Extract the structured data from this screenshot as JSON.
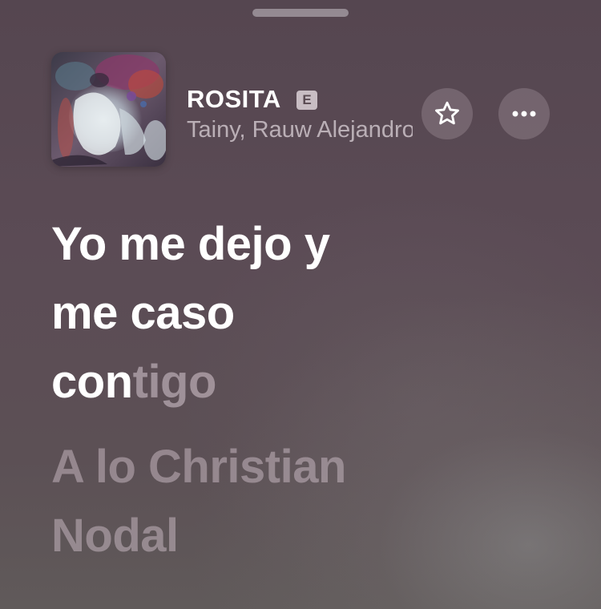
{
  "player": {
    "title": "ROSITA",
    "explicit_badge": "E",
    "artist": "Tainy, Rauw Alejandro",
    "favorite_icon": "star-icon",
    "more_icon": "ellipsis-icon"
  },
  "lyrics": {
    "active": {
      "line1": "Yo me dejo y",
      "line2": "me caso",
      "line3_sung": "con",
      "line3_unsung": "tigo"
    },
    "next": {
      "line1": "A lo Christian",
      "line2": "Nodal"
    }
  },
  "colors": {
    "background": "#5a4b52",
    "text_primary": "#ffffff",
    "text_dimmed": "#cdbec8"
  }
}
